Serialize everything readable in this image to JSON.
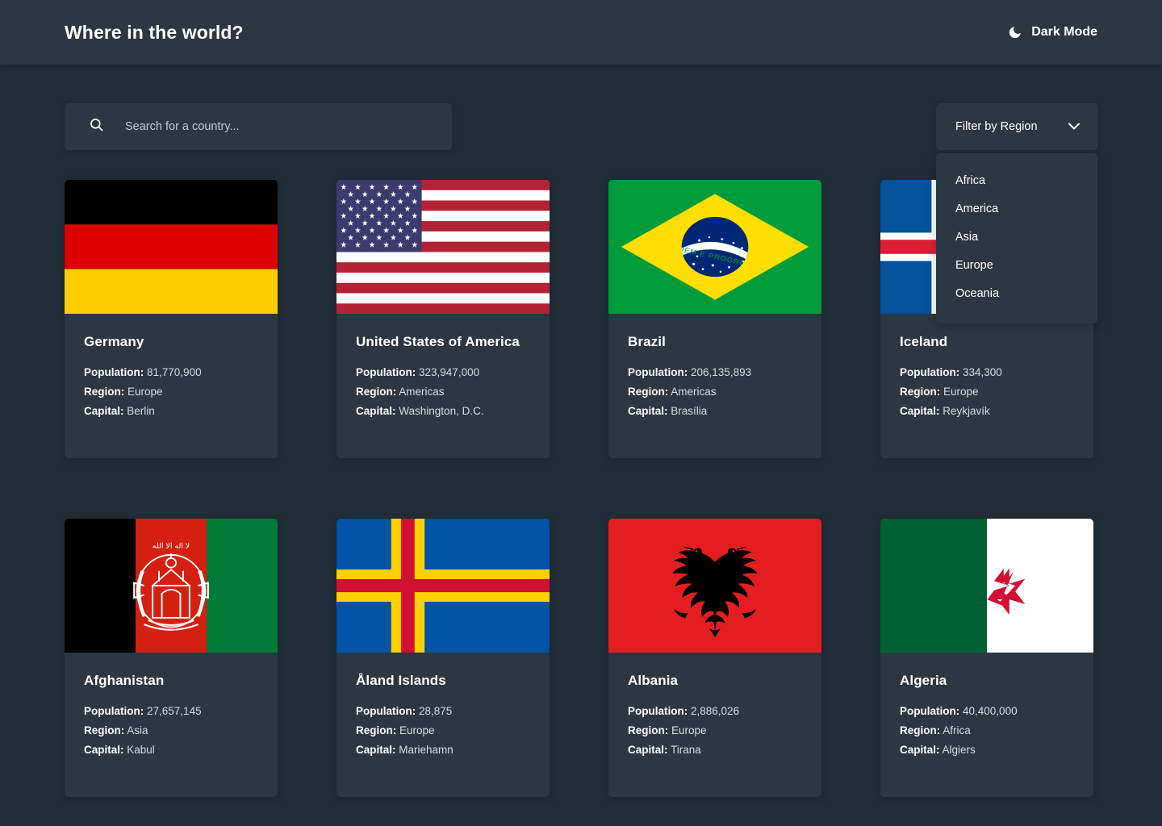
{
  "header": {
    "title": "Where in the world?",
    "theme_toggle_label": "Dark Mode",
    "theme_toggle_icon": "moon-icon"
  },
  "search": {
    "placeholder": "Search for a country...",
    "value": "",
    "icon": "search-icon"
  },
  "filter": {
    "label": "Filter by Region",
    "icon": "chevron-down-icon",
    "expanded": true,
    "options": [
      "Africa",
      "America",
      "Asia",
      "Europe",
      "Oceania"
    ]
  },
  "labels": {
    "population": "Population:",
    "region": "Region:",
    "capital": "Capital:"
  },
  "colors": {
    "page_background": "#202c36",
    "element_background": "#2b3743",
    "text": "#ffffff",
    "muted_text": "#d7dce0"
  },
  "countries": [
    {
      "name": "Germany",
      "population": "81,770,900",
      "region": "Europe",
      "capital": "Berlin",
      "flag": "germany-flag"
    },
    {
      "name": "United States of America",
      "population": "323,947,000",
      "region": "Americas",
      "capital": "Washington, D.C.",
      "flag": "united-states-flag"
    },
    {
      "name": "Brazil",
      "population": "206,135,893",
      "region": "Americas",
      "capital": "Brasília",
      "flag": "brazil-flag"
    },
    {
      "name": "Iceland",
      "population": "334,300",
      "region": "Europe",
      "capital": "Reykjavík",
      "flag": "iceland-flag"
    },
    {
      "name": "Afghanistan",
      "population": "27,657,145",
      "region": "Asia",
      "capital": "Kabul",
      "flag": "afghanistan-flag"
    },
    {
      "name": "Åland Islands",
      "population": "28,875",
      "region": "Europe",
      "capital": "Mariehamn",
      "flag": "aland-islands-flag"
    },
    {
      "name": "Albania",
      "population": "2,886,026",
      "region": "Europe",
      "capital": "Tirana",
      "flag": "albania-flag"
    },
    {
      "name": "Algeria",
      "population": "40,400,000",
      "region": "Africa",
      "capital": "Algiers",
      "flag": "algeria-flag"
    }
  ]
}
